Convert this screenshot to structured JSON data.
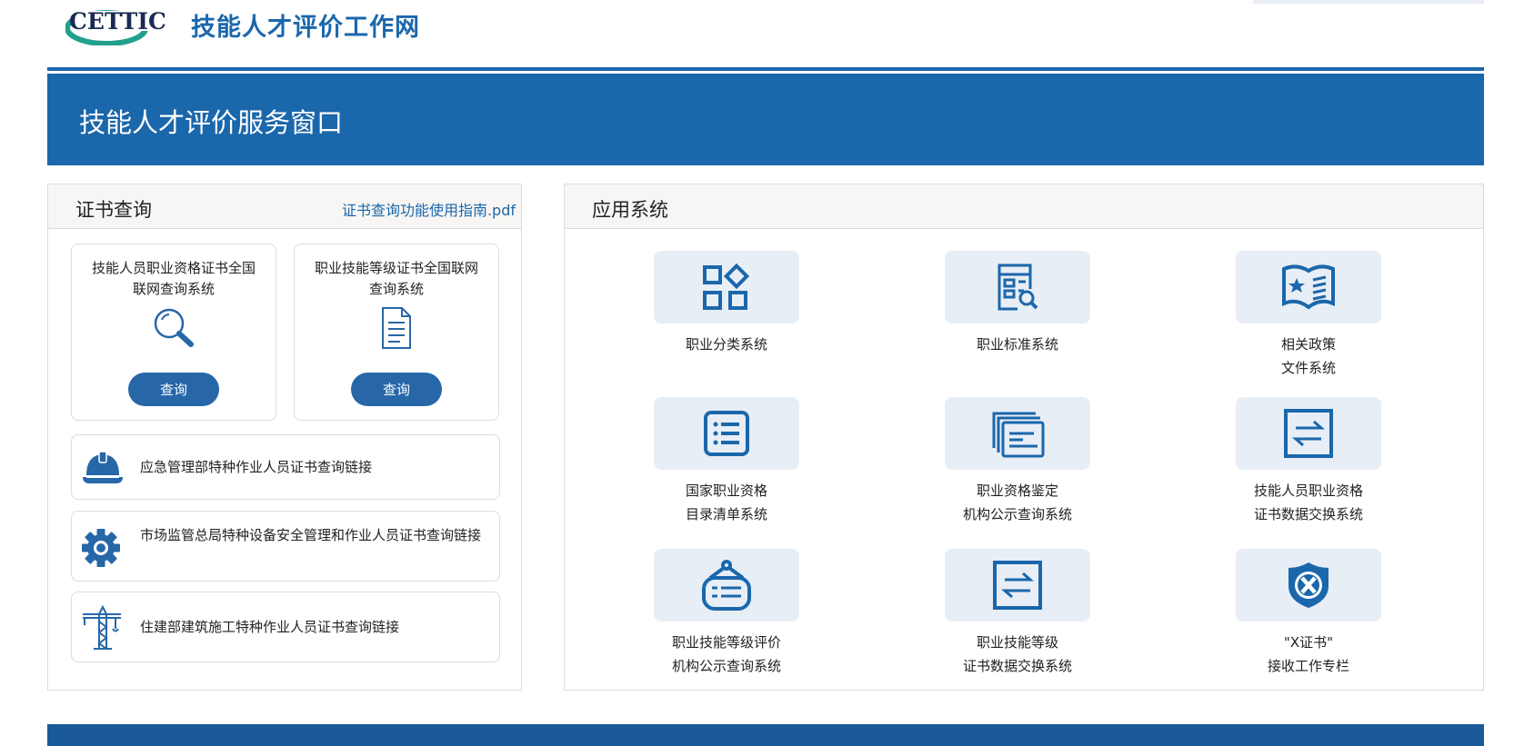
{
  "header": {
    "logo_text": "CETTIC",
    "site_title": "技能人才评价工作网"
  },
  "banner": {
    "title": "技能人才评价服务窗口"
  },
  "certificate_query": {
    "title": "证书查询",
    "guide_link": "证书查询功能使用指南.pdf",
    "cards": [
      {
        "title_line1": "技能人员职业资格证书全国",
        "title_line2": "联网查询系统",
        "icon": "search-icon",
        "button": "查询"
      },
      {
        "title_line1": "职业技能等级证书全国联网",
        "title_line2": "查询系统",
        "icon": "document-icon",
        "button": "查询"
      }
    ],
    "links": [
      {
        "icon": "safety-helmet-icon",
        "text": "应急管理部特种作业人员证书查询链接"
      },
      {
        "icon": "gear-icon",
        "text": "市场监管总局特种设备安全管理和作业人员证书查询链接"
      },
      {
        "icon": "tower-crane-icon",
        "text": "住建部建筑施工特种作业人员证书查询链接"
      }
    ]
  },
  "applications": {
    "title": "应用系统",
    "items": [
      {
        "icon": "category-grid-icon",
        "line1": "职业分类系统",
        "line2": ""
      },
      {
        "icon": "standard-search-icon",
        "line1": "职业标准系统",
        "line2": ""
      },
      {
        "icon": "policy-book-icon",
        "line1": "相关政策",
        "line2": "文件系统"
      },
      {
        "icon": "list-icon",
        "line1": "国家职业资格",
        "line2": "目录清单系统"
      },
      {
        "icon": "documents-stack-icon",
        "line1": "职业资格鉴定",
        "line2": "机构公示查询系统"
      },
      {
        "icon": "exchange-icon",
        "line1": "技能人员职业资格",
        "line2": "证书数据交换系统"
      },
      {
        "icon": "hanging-sign-icon",
        "line1": "职业技能等级评价",
        "line2": "机构公示查询系统"
      },
      {
        "icon": "exchange-icon",
        "line1": "职业技能等级",
        "line2": "证书数据交换系统"
      },
      {
        "icon": "x-shield-icon",
        "line1": "\"X证书\"",
        "line2": "接收工作专栏"
      }
    ]
  },
  "colors": {
    "primary": "#1b67ab",
    "button": "#2767a8",
    "tile_bg": "#e7eef6",
    "footer": "#1b5a99"
  }
}
